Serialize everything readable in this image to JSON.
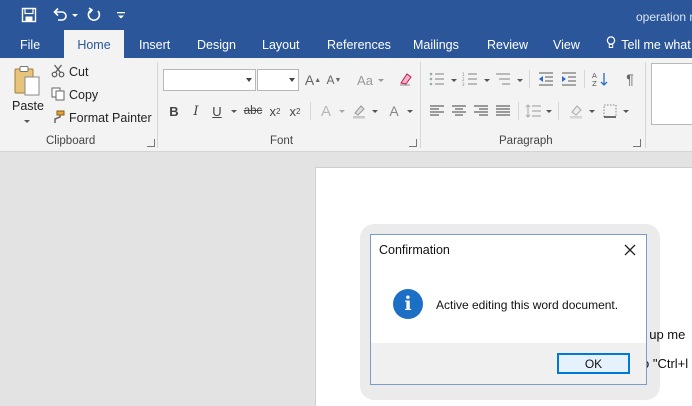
{
  "titlebar": {
    "doc_title": "operation m",
    "qat": {
      "save_icon": "save-icon",
      "undo_icon": "undo-icon",
      "redo_icon": "redo-icon",
      "customize_icon": "customize-qat-icon"
    }
  },
  "tabs": [
    {
      "label": "File"
    },
    {
      "label": "Home",
      "active": true
    },
    {
      "label": "Insert"
    },
    {
      "label": "Design"
    },
    {
      "label": "Layout"
    },
    {
      "label": "References"
    },
    {
      "label": "Mailings"
    },
    {
      "label": "Review"
    },
    {
      "label": "View"
    }
  ],
  "tell_me": "Tell me what",
  "ribbon": {
    "clipboard": {
      "paste": "Paste",
      "cut": "Cut",
      "copy": "Copy",
      "format_painter": "Format Painter",
      "label": "Clipboard"
    },
    "font": {
      "font_name": "",
      "font_size": "",
      "grow": "A",
      "shrink": "A",
      "change_case": "Aa",
      "bold": "B",
      "italic": "I",
      "underline": "U",
      "strike": "abc",
      "sub": "x",
      "sub_suffix": "2",
      "sup": "x",
      "sup_suffix": "2",
      "text_effects": "A",
      "font_color": "A",
      "label": "Font"
    },
    "paragraph": {
      "label": "Paragraph",
      "pilcrow": "¶"
    }
  },
  "document": {
    "line1": "t up me",
    "line2": "o \"Ctrl+l"
  },
  "dialog": {
    "title": "Confirmation",
    "message": "Active editing this word document.",
    "ok": "OK",
    "info_glyph": "i"
  },
  "colors": {
    "accent": "#2b579a",
    "info": "#1c6fc4",
    "ok_border": "#0078d7"
  }
}
